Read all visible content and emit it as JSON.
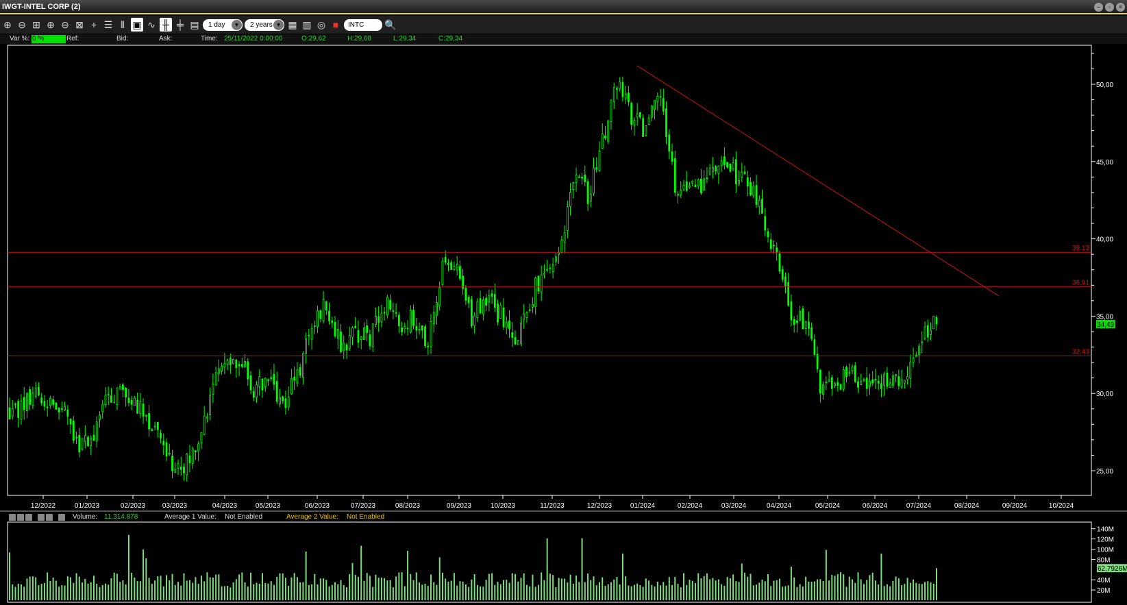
{
  "window": {
    "title": "IWGT-INTEL CORP (2)"
  },
  "toolbar": {
    "interval": "1 day",
    "range": "2 years",
    "symbol": "INTC"
  },
  "info": {
    "var_label": "Var %:",
    "var_value": "0 %",
    "ref_label": "Ref:",
    "bid_label": "Bid:",
    "ask_label": "Ask:",
    "time_label": "Time:",
    "time_value": "25/11/2022 0:00:00",
    "open": "O:29,62",
    "high": "H:29,68",
    "low": "L:29,34",
    "close": "C:29,34"
  },
  "volume_header": {
    "volume_label": "Volume:",
    "volume_value": "11.314.878",
    "avg1_label": "Average 1 Value:",
    "avg1_value": "Not Enabled",
    "avg2_label": "Average 2 Value:",
    "avg2_value": "Not Enabled"
  },
  "colors": {
    "candle": "#00ff00",
    "level": "#d01010",
    "volume": "#7ddc7d",
    "avg2": "#e8c000"
  },
  "chart_data": [
    {
      "type": "candlestick",
      "title": "INTEL CORP daily",
      "ylim": [
        24,
        53
      ],
      "y_ticks": [
        "25,00",
        "30,00",
        "35,00",
        "40,00",
        "45,00",
        "50,00"
      ],
      "x_ticks": [
        "12/2022",
        "01/2023",
        "02/2023",
        "03/2023",
        "04/2023",
        "05/2023",
        "06/2023",
        "07/2023",
        "08/2023",
        "09/2023",
        "10/2023",
        "11/2023",
        "12/2023",
        "01/2024",
        "02/2024",
        "03/2024",
        "04/2024",
        "05/2024",
        "06/2024",
        "07/2024",
        "08/2024",
        "09/2024",
        "10/2024"
      ],
      "weekly_closes": [
        28.9,
        30.3,
        29.4,
        28.5,
        26.6,
        27.5,
        29.8,
        30.0,
        29.4,
        28.0,
        25.6,
        25.2,
        26.6,
        29.4,
        32.6,
        32.2,
        30.3,
        30.7,
        29.4,
        31.2,
        34.0,
        35.9,
        33.1,
        34.0,
        33.6,
        35.9,
        34.5,
        35.0,
        33.1,
        38.2,
        37.7,
        35.0,
        36.4,
        35.0,
        32.6,
        35.9,
        38.2,
        38.7,
        43.8,
        42.9,
        46.1,
        50.3,
        48.0,
        47.0,
        49.4,
        43.3,
        42.9,
        43.8,
        44.7,
        44.3,
        43.8,
        41.5,
        38.7,
        35.0,
        34.5,
        30.7,
        30.3,
        31.7,
        30.3,
        30.5,
        30.7,
        31.2,
        34.0,
        34.49
      ],
      "levels": [
        {
          "value": 39.13,
          "label": "39.13"
        },
        {
          "value": 36.91,
          "label": "36.91"
        },
        {
          "value": 32.43,
          "label": "32.43"
        }
      ],
      "trendline": {
        "from": {
          "date": "12/2023",
          "price": 51.2
        },
        "to": {
          "date": "08/2024",
          "price": 36.3
        }
      },
      "last_price": "34,49"
    },
    {
      "type": "bar",
      "title": "Volume",
      "y_ticks": [
        "20M",
        "40M",
        "80M",
        "100M",
        "120M",
        "140M"
      ],
      "ylim": [
        0,
        150
      ],
      "unit": "M",
      "last_value": "62,7926M"
    }
  ]
}
